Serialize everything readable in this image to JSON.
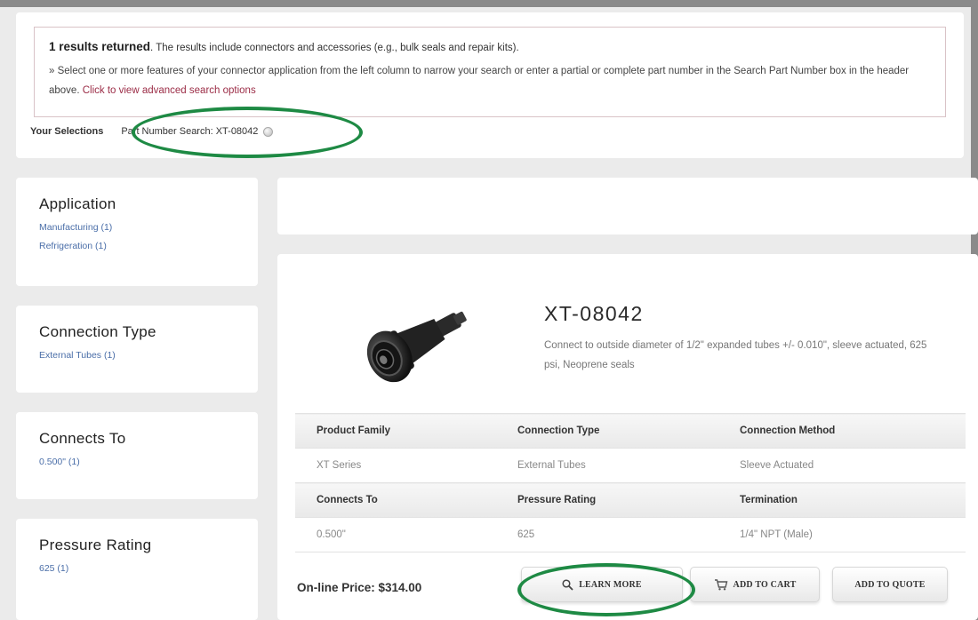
{
  "results": {
    "count_text": "1 results returned",
    "summary_text": ". The results include connectors and accessories (e.g., bulk seals and repair kits).",
    "instructions_text": "» Select one or more features of your connector application from the left column to narrow your search or enter a partial or complete part number in the Search Part Number box in the header above.",
    "advanced_link": "Click to view advanced search options"
  },
  "selections": {
    "label": "Your Selections",
    "value": "Part Number Search: XT-08042"
  },
  "facets": [
    {
      "title": "Application",
      "links": [
        "Manufacturing (1)",
        "Refrigeration (1)"
      ]
    },
    {
      "title": "Connection Type",
      "links": [
        "External Tubes (1)"
      ]
    },
    {
      "title": "Connects To",
      "links": [
        "0.500\" (1)"
      ]
    },
    {
      "title": "Pressure Rating",
      "links": [
        "625 (1)"
      ]
    }
  ],
  "product": {
    "title": "XT-08042",
    "description": "Connect to outside diameter of 1/2\" expanded tubes +/- 0.010\", sleeve actuated, 625 psi, Neoprene seals",
    "specs": [
      {
        "headers": [
          "Product Family",
          "Connection Type",
          "Connection Method"
        ],
        "values": [
          "XT Series",
          "External Tubes",
          "Sleeve Actuated"
        ]
      },
      {
        "headers": [
          "Connects To",
          "Pressure Rating",
          "Termination"
        ],
        "values": [
          "0.500\"",
          "625",
          "1/4\" NPT (Male)"
        ]
      }
    ],
    "price": "On-line Price: $314.00"
  },
  "buttons": {
    "learn_more": "LEARN MORE",
    "add_to_cart": "ADD TO CART",
    "add_to_quote": "ADD TO QUOTE"
  },
  "icons": {
    "learn_more": "magnifier-icon",
    "add_to_cart": "cart-icon",
    "remove_selection": "remove-selection-icon"
  },
  "colors": {
    "highlight_circle": "#1e8a44",
    "link": "#4a6ea8",
    "advanced_link": "#9b2c46"
  }
}
